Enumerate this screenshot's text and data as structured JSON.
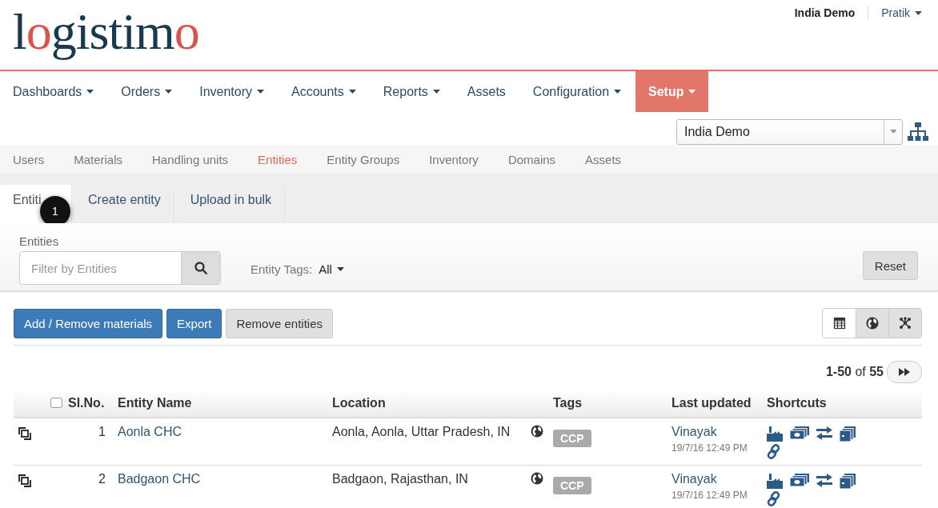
{
  "logo": [
    {
      "text": "l",
      "accent": false
    },
    {
      "text": "o",
      "accent": true
    },
    {
      "text": "gistim",
      "accent": false
    },
    {
      "text": "o",
      "accent": true
    }
  ],
  "account": {
    "domain": "India Demo",
    "user": "Pratik"
  },
  "nav": [
    {
      "label": "Dashboards",
      "dropdown": true,
      "selected": false
    },
    {
      "label": "Orders",
      "dropdown": true,
      "selected": false
    },
    {
      "label": "Inventory",
      "dropdown": true,
      "selected": false
    },
    {
      "label": "Accounts",
      "dropdown": true,
      "selected": false
    },
    {
      "label": "Reports",
      "dropdown": true,
      "selected": false
    },
    {
      "label": "Assets",
      "dropdown": false,
      "selected": false
    },
    {
      "label": "Configuration",
      "dropdown": true,
      "selected": false
    },
    {
      "label": "Setup",
      "dropdown": true,
      "selected": true
    }
  ],
  "domain_select": {
    "value": "India Demo"
  },
  "subnav": [
    {
      "label": "Users",
      "selected": false
    },
    {
      "label": "Materials",
      "selected": false
    },
    {
      "label": "Handling units",
      "selected": false
    },
    {
      "label": "Entities",
      "selected": true
    },
    {
      "label": "Entity Groups",
      "selected": false
    },
    {
      "label": "Inventory",
      "selected": false
    },
    {
      "label": "Domains",
      "selected": false
    },
    {
      "label": "Assets",
      "selected": false
    }
  ],
  "tabs": [
    {
      "label": "Entiti",
      "selected": true
    },
    {
      "label": "Create entity",
      "selected": false
    },
    {
      "label": "Upload in bulk",
      "selected": false
    }
  ],
  "step_badge": "1",
  "filter": {
    "label": "Entities",
    "placeholder": "Filter by Entities",
    "tags_label": "Entity Tags:",
    "tags_value": "All",
    "reset": "Reset"
  },
  "actions": [
    {
      "label": "Add / Remove materials",
      "kind": "primary"
    },
    {
      "label": "Export",
      "kind": "primary"
    },
    {
      "label": "Remove entities",
      "kind": "default"
    }
  ],
  "views": [
    {
      "kind": "table",
      "selected": true
    },
    {
      "kind": "map",
      "selected": false
    },
    {
      "kind": "network",
      "selected": false
    }
  ],
  "pagination": "**1-50** of **55**",
  "table": {
    "select_all": {
      "checked": false
    },
    "columns": [
      "Sl.No.",
      "Entity Name",
      "Location",
      "Tags",
      "Last updated",
      "Shortcuts"
    ],
    "rows": [
      {
        "number": "1",
        "name": "Aonla CHC",
        "location": "Aonla, Aonla, Uttar Pradesh, IN",
        "tag": "CCP",
        "updated_by": "Vinayak",
        "updated_at": "19/7/16 12:49 PM"
      },
      {
        "number": "2",
        "name": "Badgaon CHC",
        "location": "Badgaon, Rajasthan, IN",
        "tag": "CCP",
        "updated_by": "Vinayak",
        "updated_at": "19/7/16 12:49 PM"
      }
    ]
  }
}
